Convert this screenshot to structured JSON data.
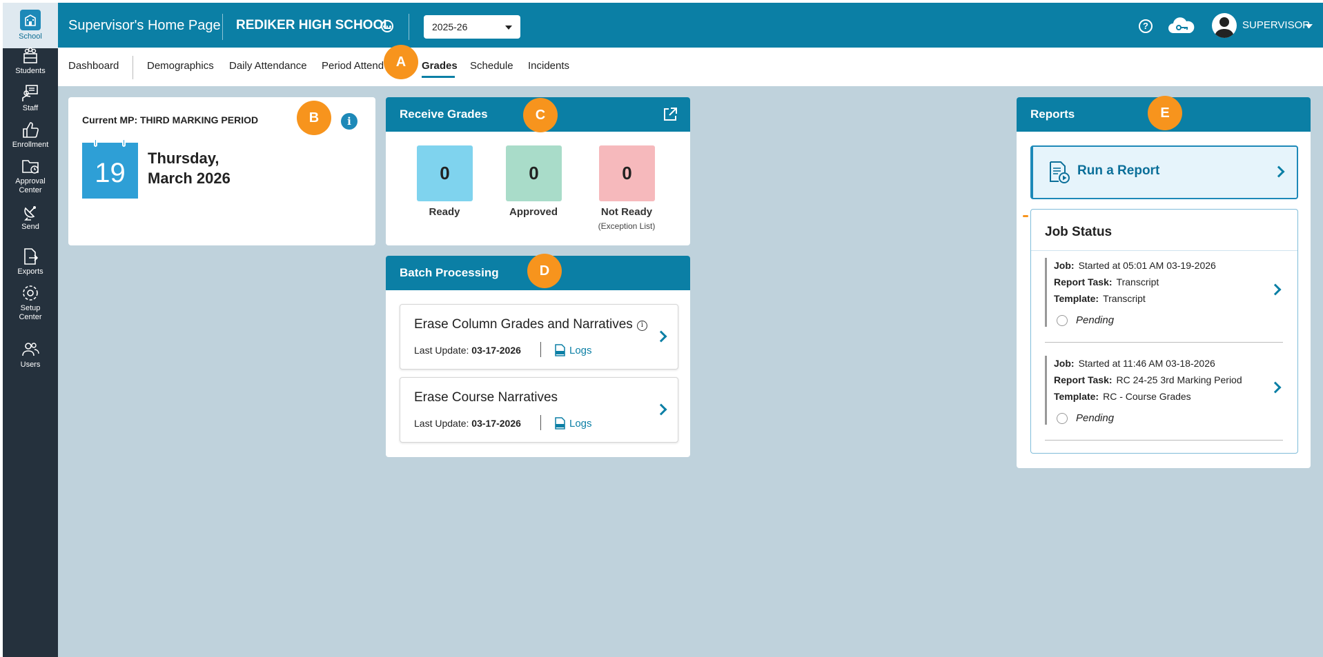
{
  "sidebar": {
    "items": [
      {
        "label": "School",
        "icon": "school-icon"
      },
      {
        "label": "Students",
        "icon": "students-icon"
      },
      {
        "label": "Staff",
        "icon": "staff-icon"
      },
      {
        "label": "Enrollment",
        "icon": "thumbs-up-icon"
      },
      {
        "label": "Approval Center",
        "icon": "folder-clock-icon"
      },
      {
        "label": "Send",
        "icon": "satellite-icon"
      },
      {
        "label": "Exports",
        "icon": "export-icon"
      },
      {
        "label": "Setup Center",
        "icon": "gear-icon"
      },
      {
        "label": "Users",
        "icon": "users-icon"
      }
    ],
    "active": "School"
  },
  "header": {
    "title": "Supervisor's Home Page",
    "school": "REDIKER HIGH SCHOOL",
    "year": "2025-26",
    "user": "SUPERVISOR",
    "help_glyph": "?",
    "bg_color": "#0b7fa5"
  },
  "tabs": {
    "items": [
      "Dashboard",
      "Demographics",
      "Daily Attendance",
      "Period Attend",
      "Grades",
      "Schedule",
      "Incidents"
    ],
    "active": "Grades"
  },
  "badges": [
    "A",
    "B",
    "C",
    "D",
    "E"
  ],
  "marking_period": {
    "label": "Current MP: THIRD MARKING PERIOD",
    "day": "19",
    "weekday": "Thursday,",
    "month_year": "March 2026",
    "info_glyph": "i"
  },
  "receive_grades": {
    "title": "Receive Grades",
    "items": [
      {
        "value": "0",
        "label": "Ready",
        "sub": "",
        "color": "#7fd3ee"
      },
      {
        "value": "0",
        "label": "Approved",
        "sub": "",
        "color": "#a9dcc9"
      },
      {
        "value": "0",
        "label": "Not Ready",
        "sub": "(Exception List)",
        "color": "#f6b9bc"
      }
    ]
  },
  "batch": {
    "title": "Batch Processing",
    "items": [
      {
        "title": "Erase Column Grades and Narratives",
        "info_glyph": "i",
        "update_label": "Last Update:",
        "update_date": "03-17-2026",
        "logs": "Logs"
      },
      {
        "title": "Erase Course Narratives",
        "update_label": "Last Update:",
        "update_date": "03-17-2026",
        "logs": "Logs"
      }
    ]
  },
  "reports": {
    "title": "Reports",
    "run_label": "Run a Report",
    "job_status_title": "Job Status",
    "jobs": [
      {
        "job_label": "Job:",
        "job": "Started at 05:01 AM 03-19-2026",
        "task_label": "Report Task:",
        "task": "Transcript",
        "template_label": "Template:",
        "template": "Transcript",
        "status": "Pending"
      },
      {
        "job_label": "Job:",
        "job": "Started at 11:46 AM 03-18-2026",
        "task_label": "Report Task:",
        "task": "RC 24-25 3rd Marking Period",
        "template_label": "Template:",
        "template": "RC - Course Grades",
        "status": "Pending"
      }
    ]
  },
  "colors": {
    "accent": "#0b7fa5",
    "badge": "#f7941d",
    "sidebar": "#25313d",
    "background": "#bfd2dc"
  }
}
